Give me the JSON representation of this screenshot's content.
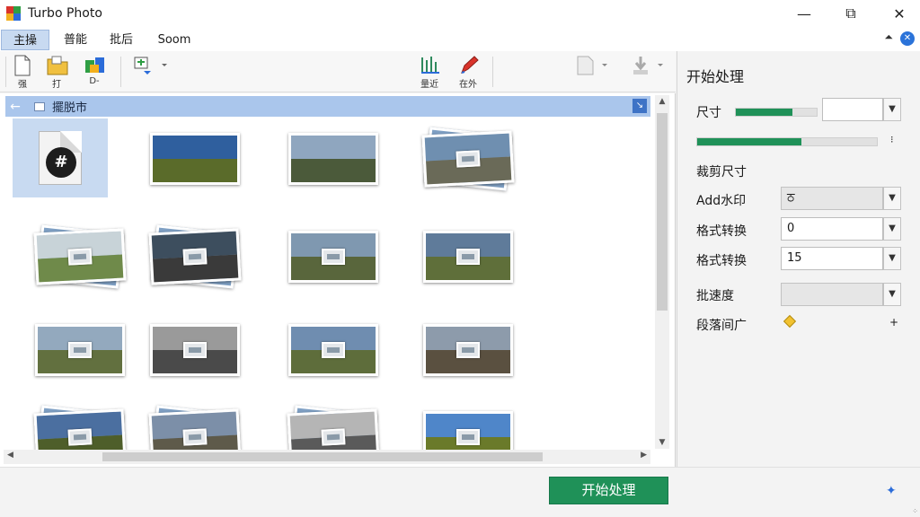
{
  "window": {
    "title": "Turbo Photo",
    "minimize": "—",
    "maximize": "⧉",
    "close": "✕"
  },
  "menu": {
    "items": [
      "主操",
      "普能",
      "批后",
      "Soom"
    ],
    "collapse": "⏶",
    "help": "✕"
  },
  "toolbar": {
    "tools": [
      {
        "label": "强",
        "icon": "new-file-icon"
      },
      {
        "label": "打",
        "icon": "open-folder-icon"
      },
      {
        "label": "D-",
        "icon": "save-icon"
      },
      {
        "label": "",
        "icon": "convert-icon"
      },
      {
        "label": "量近",
        "icon": "batch-icon"
      },
      {
        "label": "在外",
        "icon": "edit-icon"
      },
      {
        "label": "",
        "icon": "export-icon"
      },
      {
        "label": "",
        "icon": "download-icon"
      }
    ]
  },
  "browser": {
    "breadcrumb": "擺脱市",
    "back": "←",
    "expand": "↘",
    "thumbnails": [
      {
        "type": "file",
        "badge": "#"
      },
      {
        "type": "photo",
        "sky": "#2f5f9e",
        "land": "#5a6b2a"
      },
      {
        "type": "photo",
        "sky": "#8fa6bf",
        "land": "#4b5a3a"
      },
      {
        "type": "stack",
        "sky": "#6f8fb0",
        "land": "#6a6a58"
      },
      {
        "type": "stack",
        "sky": "#c8d3d8",
        "land": "#6f8a4a"
      },
      {
        "type": "stack",
        "sky": "#3d4e5e",
        "land": "#3a3a3a"
      },
      {
        "type": "photo",
        "sky": "#7f98b0",
        "land": "#59663c"
      },
      {
        "type": "photo",
        "sky": "#5f7b9a",
        "land": "#5f6f3a"
      },
      {
        "type": "photo",
        "sky": "#93a9be",
        "land": "#62703f"
      },
      {
        "type": "photo",
        "sky": "#9a9a9a",
        "land": "#4a4a4a"
      },
      {
        "type": "photo",
        "sky": "#6f8db0",
        "land": "#5e6d3b"
      },
      {
        "type": "photo",
        "sky": "#8d9bab",
        "land": "#5a5040"
      },
      {
        "type": "stack",
        "sky": "#4b6fa0",
        "land": "#4e5e2a"
      },
      {
        "type": "stack",
        "sky": "#7c8fa8",
        "land": "#5e5a4a"
      },
      {
        "type": "stack",
        "sky": "#b5b5b5",
        "land": "#5a5a5a"
      },
      {
        "type": "photo",
        "sky": "#4f86c9",
        "land": "#6a7a2a"
      }
    ]
  },
  "panel": {
    "title": "开始处理",
    "size_label": "尺寸",
    "size_progress": 0.7,
    "size_value": "",
    "slider_progress": 0.58,
    "slider_tick": "⁝",
    "crop_label": "裁剪尺寸",
    "watermark_label": "Add水印",
    "watermark_value": "ਠ",
    "format1_label": "格式转换",
    "format1_value": "0",
    "format2_label": "格式转换",
    "format2_value": "15",
    "speed_label": "批速度",
    "speed_value": "",
    "interval_label": "段落间广",
    "interval_plus": "+"
  },
  "footer": {
    "start_button": "开始处理",
    "nav_icon": "✦",
    "grip": "⁘"
  },
  "colors": {
    "accent_green": "#1f9158",
    "selection_blue": "#c8daf1",
    "breadcrumb_blue": "#aac6ec"
  }
}
